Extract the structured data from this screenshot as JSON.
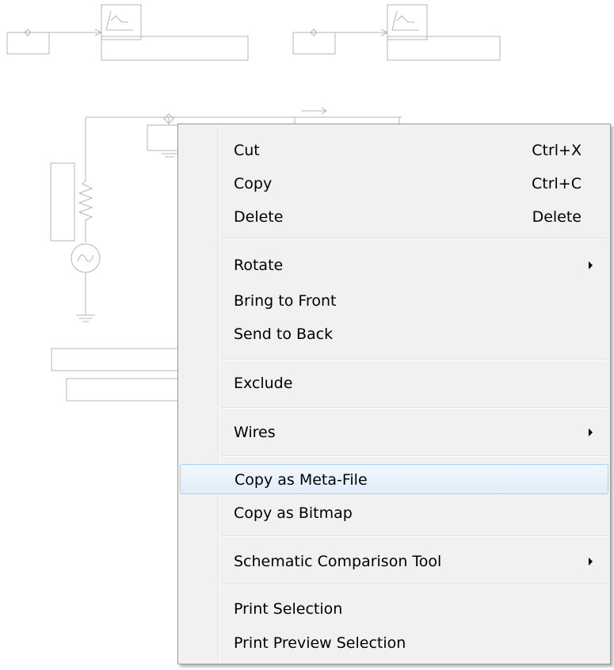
{
  "context_menu": {
    "cut": {
      "label": "Cut",
      "shortcut": "Ctrl+X"
    },
    "copy": {
      "label": "Copy",
      "shortcut": "Ctrl+C"
    },
    "delete": {
      "label": "Delete",
      "shortcut": "Delete"
    },
    "rotate": {
      "label": "Rotate"
    },
    "bring_to_front": {
      "label": "Bring to Front"
    },
    "send_to_back": {
      "label": "Send to Back"
    },
    "exclude": {
      "label": "Exclude"
    },
    "wires": {
      "label": "Wires"
    },
    "copy_as_metafile": {
      "label": "Copy as Meta-File"
    },
    "copy_as_bitmap": {
      "label": "Copy as Bitmap"
    },
    "schematic_comparison_tool": {
      "label": "Schematic Comparison Tool"
    },
    "print_selection": {
      "label": "Print Selection"
    },
    "print_preview_selection": {
      "label": "Print Preview Selection"
    }
  },
  "colors": {
    "wire": "#b4b4b4",
    "menu_background": "#f1f1f1",
    "highlight_border": "#aecff7"
  }
}
